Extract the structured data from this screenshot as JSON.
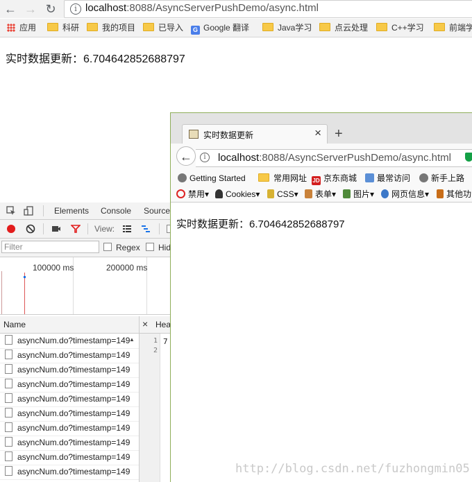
{
  "chrome": {
    "url_host": "localhost",
    "url_path": ":8088/AsyncServerPushDemo/async.html",
    "bookmarks": [
      "应用",
      "科研",
      "我的项目",
      "已导入",
      "Google 翻译",
      "Java学习",
      "点云处理",
      "C++学习",
      "前端学"
    ]
  },
  "page": {
    "text": "实时数据更新：6.704642852688797"
  },
  "devtools": {
    "tabs": [
      "Elements",
      "Console",
      "Source"
    ],
    "view_label": "View:",
    "filter_placeholder": "Filter",
    "regex_label": "Regex",
    "hide_label": "Hid",
    "timeline_ticks": [
      "100000 ms",
      "200000 ms"
    ],
    "column_name": "Name",
    "column_headers": "Hea",
    "gutter_lines": [
      "1",
      "2"
    ],
    "preview_text": "7",
    "requests": [
      "asyncNum.do?timestamp=149",
      "asyncNum.do?timestamp=149",
      "asyncNum.do?timestamp=149",
      "asyncNum.do?timestamp=149",
      "asyncNum.do?timestamp=149",
      "asyncNum.do?timestamp=149",
      "asyncNum.do?timestamp=149",
      "asyncNum.do?timestamp=149",
      "asyncNum.do?timestamp=149",
      "asyncNum.do?timestamp=149"
    ]
  },
  "firefox": {
    "tab_title": "实时数据更新",
    "url_host": "localhost",
    "url_path": ":8088/AsyncServerPushDemo/async.html",
    "bookmarks": [
      "Getting Started",
      "常用网址",
      "京东商城",
      "最常访问",
      "新手上路"
    ],
    "jd_badge": "JD",
    "tools": [
      "禁用▾",
      "Cookies▾",
      "CSS▾",
      "表单▾",
      "图片▾",
      "网页信息▾",
      "其他功"
    ],
    "page_text": "实时数据更新：6.704642852688797"
  },
  "watermark": "http://blog.csdn.net/fuzhongmin05"
}
